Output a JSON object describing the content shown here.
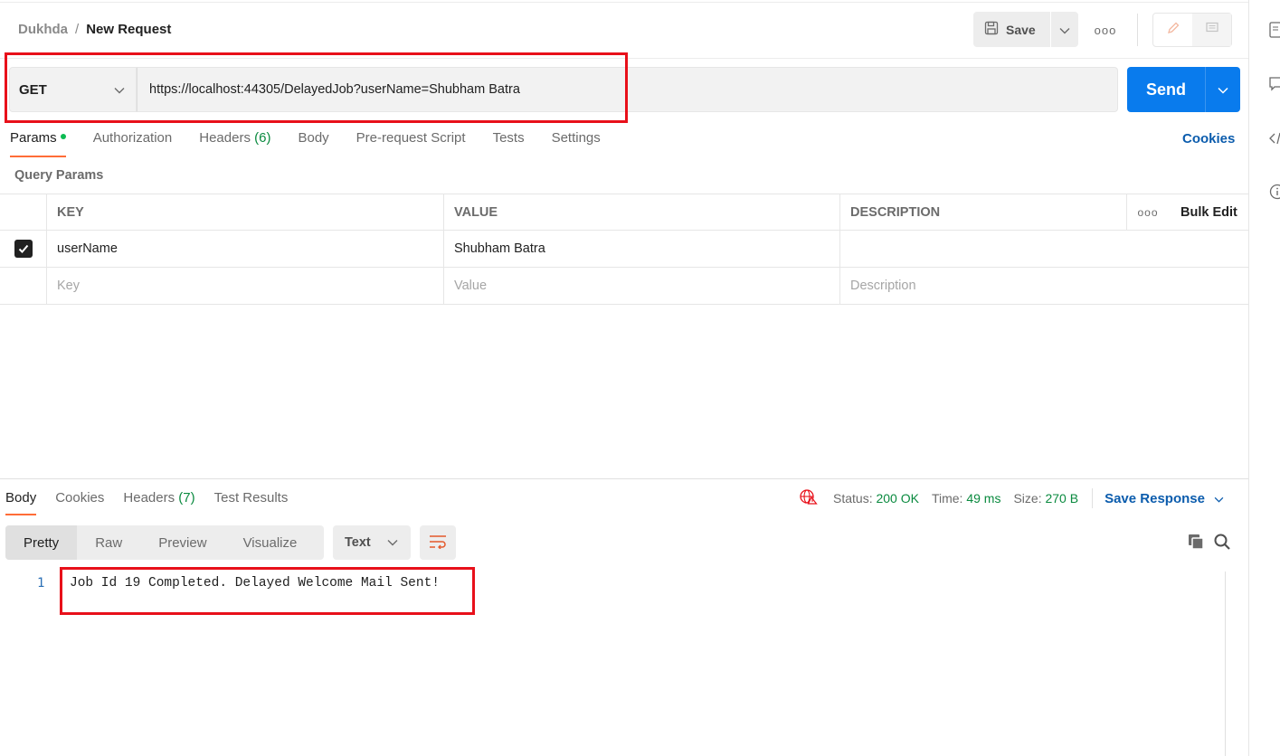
{
  "header": {
    "breadcrumb_parent": "Dukhda",
    "breadcrumb_sep": "/",
    "breadcrumb_current": "New Request",
    "save_label": "Save",
    "more_label": "ooo"
  },
  "request": {
    "method": "GET",
    "url": "https://localhost:44305/DelayedJob?userName=Shubham Batra",
    "send_label": "Send"
  },
  "request_tabs": [
    {
      "label": "Params",
      "count": ""
    },
    {
      "label": "Authorization",
      "count": ""
    },
    {
      "label": "Headers",
      "count": "(6)"
    },
    {
      "label": "Body",
      "count": ""
    },
    {
      "label": "Pre-request Script",
      "count": ""
    },
    {
      "label": "Tests",
      "count": ""
    },
    {
      "label": "Settings",
      "count": ""
    }
  ],
  "cookies_link": "Cookies",
  "query_params": {
    "title": "Query Params",
    "columns": {
      "key": "KEY",
      "value": "VALUE",
      "description": "DESCRIPTION",
      "more": "ooo",
      "bulk_edit": "Bulk Edit"
    },
    "rows": [
      {
        "key": "userName",
        "value": "Shubham Batra",
        "description": "",
        "checked": true
      }
    ],
    "placeholders": {
      "key": "Key",
      "value": "Value",
      "description": "Description"
    }
  },
  "response": {
    "tabs": [
      {
        "label": "Body",
        "count": ""
      },
      {
        "label": "Cookies",
        "count": ""
      },
      {
        "label": "Headers",
        "count": "(7)"
      },
      {
        "label": "Test Results",
        "count": ""
      }
    ],
    "status_label": "Status:",
    "status_value": "200 OK",
    "time_label": "Time:",
    "time_value": "49 ms",
    "size_label": "Size:",
    "size_value": "270 B",
    "save_response": "Save Response",
    "view_modes": [
      "Pretty",
      "Raw",
      "Preview",
      "Visualize"
    ],
    "format": "Text",
    "line_number": "1",
    "body_text": "Job Id 19 Completed. Delayed Welcome Mail Sent!"
  },
  "colors": {
    "accent": "#ff6c37",
    "send": "#097bed",
    "highlight": "#e8101a",
    "success": "#0a8a3f",
    "link": "#0b5cad"
  }
}
